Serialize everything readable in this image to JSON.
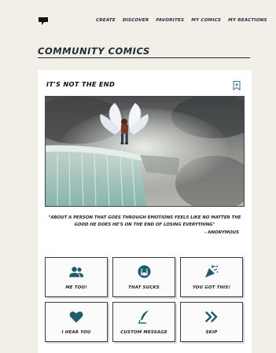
{
  "nav": {
    "items": [
      "CREATE",
      "DISCOVER",
      "FAVORITES",
      "MY COMICS",
      "MY REACTIONS"
    ]
  },
  "section": {
    "title": "COMMUNITY COMICS"
  },
  "comic": {
    "title": "IT'S NOT THE END",
    "quote": "\"ABOUT A PERSON THAT GOES THROUGH EMOTIONS FEELS LIKE NO MATTER THE GOOD HE DOES HE'S ON THE END OF LOSING EVERYTHING\"",
    "author": "- ANONYMOUS"
  },
  "reactions": [
    {
      "label": "ME TOO!",
      "icon": "users-icon"
    },
    {
      "label": "THAT SUCKS",
      "icon": "crying-face-icon"
    },
    {
      "label": "YOU GOT THIS!",
      "icon": "party-popper-icon"
    },
    {
      "label": "I HEAR YOU",
      "icon": "heart-icon"
    },
    {
      "label": "CUSTOM MESSAGE",
      "icon": "feather-pen-icon"
    },
    {
      "label": "SKIP",
      "icon": "double-chevron-right-icon"
    }
  ],
  "colors": {
    "background": "#f2eee8",
    "accent": "#1e5c6b",
    "text": "#1f2a33"
  }
}
